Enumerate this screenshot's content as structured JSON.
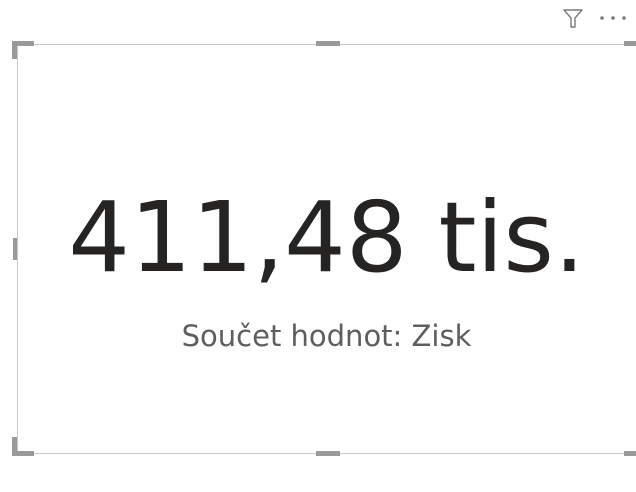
{
  "toolbar": {
    "filter_icon": "filter-icon",
    "more_icon": "more-options-icon",
    "more_glyph": "···"
  },
  "card": {
    "value": "411,48 tis.",
    "label": "Součet hodnot: Zisk"
  },
  "colors": {
    "value_text": "#252423",
    "label_text": "#605e5c",
    "frame_border": "#c8c8c8",
    "handles": "#9a9a9a",
    "icons": "#7a7a7a"
  }
}
